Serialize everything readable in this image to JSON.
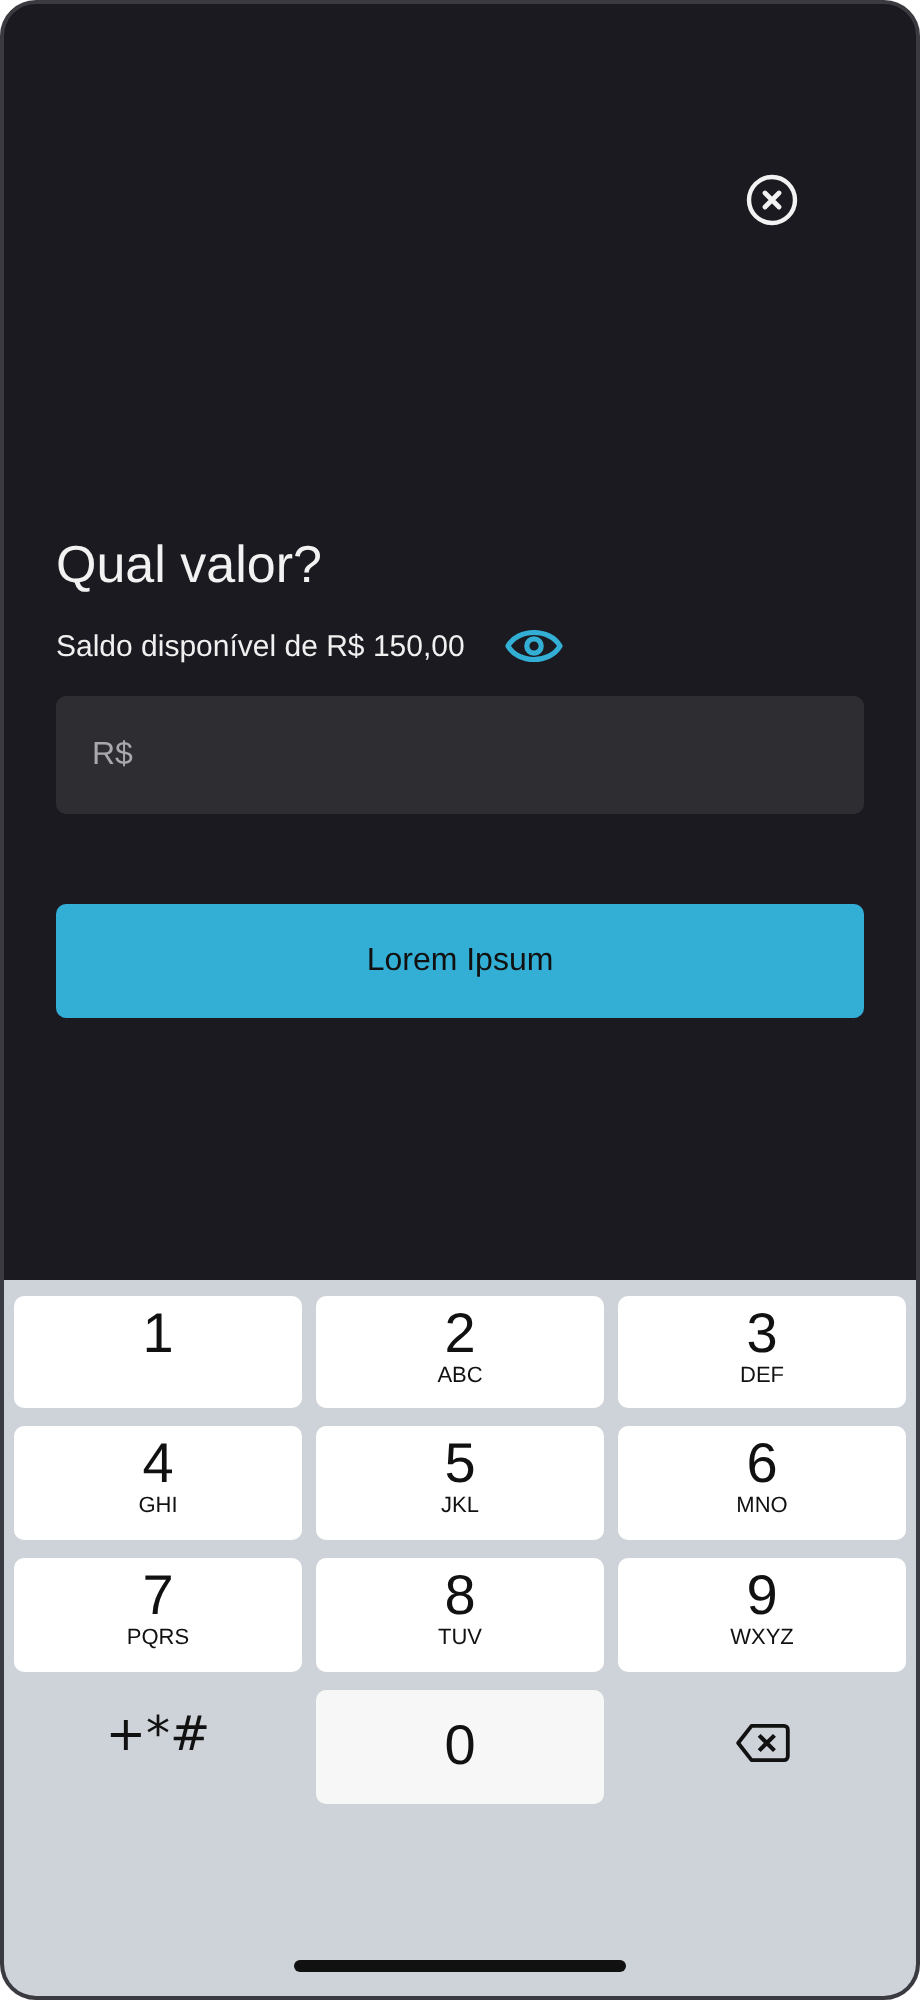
{
  "title": "Qual valor?",
  "balance": {
    "text": "Saldo disponível de R$ 150,00",
    "visible": true
  },
  "amount_field": {
    "placeholder": "R$"
  },
  "submit_button": {
    "label": "Lorem Ipsum"
  },
  "keypad": [
    {
      "kind": "digit",
      "digit": "1",
      "pressed": false
    },
    {
      "kind": "digit",
      "digit": "2",
      "letters": "ABC",
      "pressed": false
    },
    {
      "kind": "digit",
      "digit": "3",
      "letters": "DEF",
      "pressed": false
    },
    {
      "kind": "digit",
      "digit": "4",
      "letters": "GHI",
      "pressed": false
    },
    {
      "kind": "digit",
      "digit": "5",
      "letters": "JKL",
      "pressed": false
    },
    {
      "kind": "digit",
      "digit": "6",
      "letters": "MNO",
      "pressed": false
    },
    {
      "kind": "digit",
      "digit": "7",
      "letters": "PQRS",
      "pressed": false
    },
    {
      "kind": "digit",
      "digit": "8",
      "letters": "TUV",
      "pressed": false
    },
    {
      "kind": "digit",
      "digit": "9",
      "letters": "WXYZ",
      "pressed": false
    },
    {
      "kind": "symbols",
      "text": "+*#"
    },
    {
      "kind": "digit",
      "digit": "0",
      "pressed": true
    },
    {
      "kind": "backspace"
    }
  ]
}
